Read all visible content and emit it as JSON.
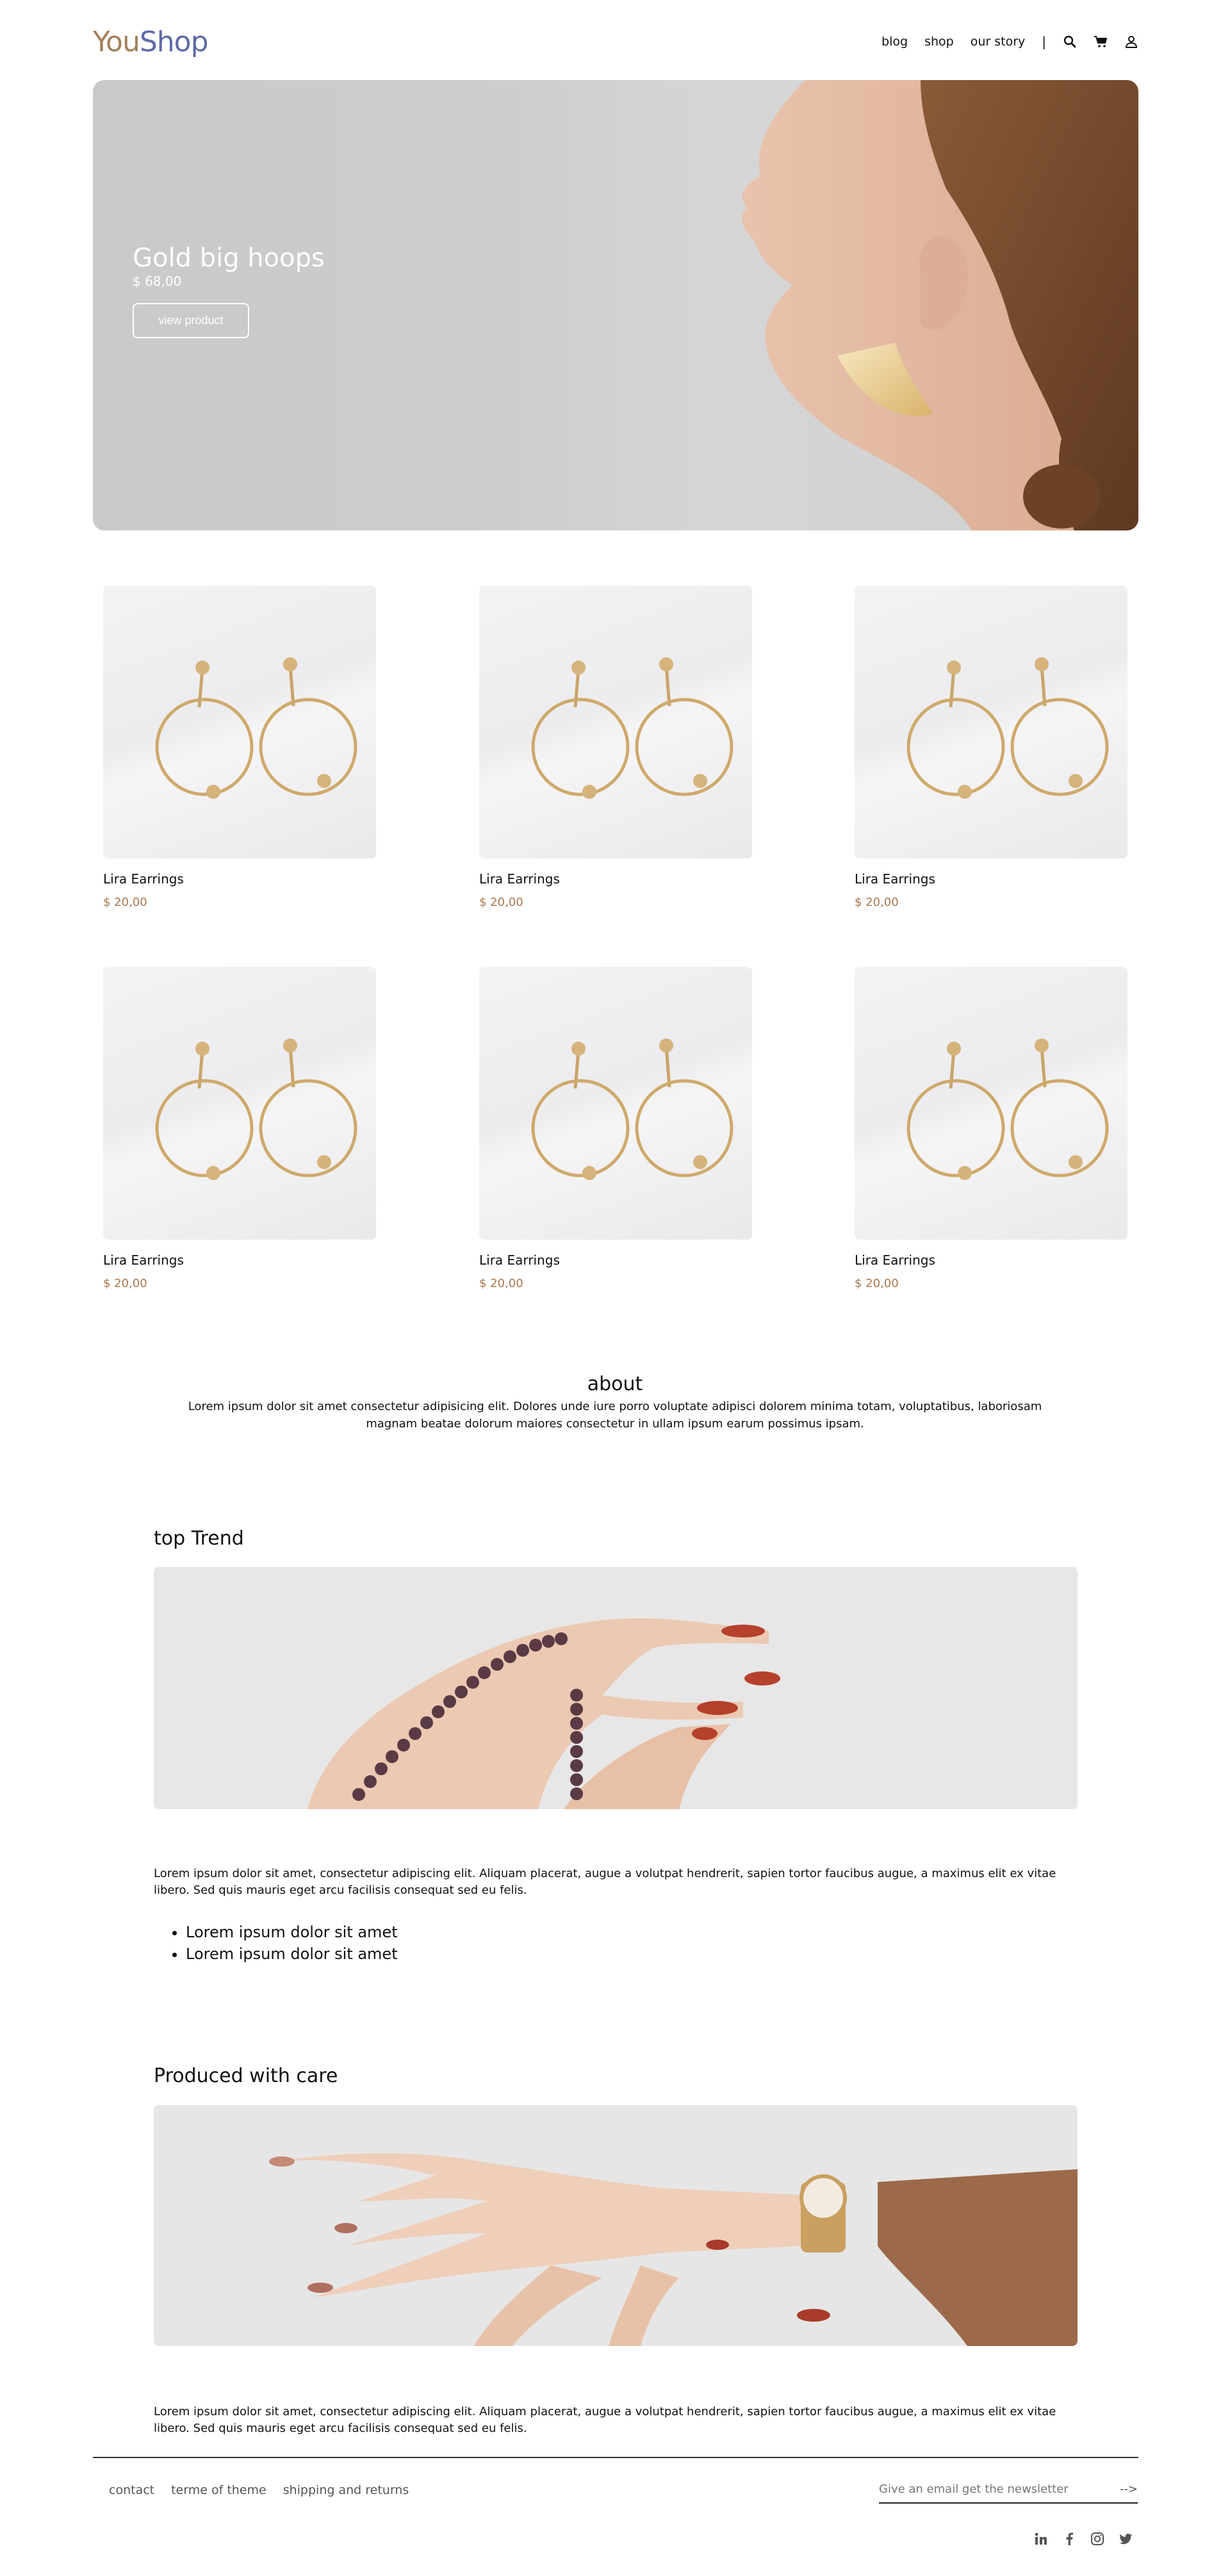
{
  "brand": {
    "logo_part1": "You",
    "logo_part2": "Shop"
  },
  "nav": {
    "blog": "blog",
    "shop": "shop",
    "our_story": "our story",
    "separator": "|"
  },
  "hero": {
    "title": "Gold big hoops",
    "price": "$ 68,00",
    "button": "view product"
  },
  "products": [
    {
      "name": "Lira Earrings",
      "price": "$ 20,00"
    },
    {
      "name": "Lira Earrings",
      "price": "$ 20,00"
    },
    {
      "name": "Lira Earrings",
      "price": "$ 20,00"
    },
    {
      "name": "Lira Earrings",
      "price": "$ 20,00"
    },
    {
      "name": "Lira Earrings",
      "price": "$ 20,00"
    },
    {
      "name": "Lira Earrings",
      "price": "$ 20,00"
    }
  ],
  "about": {
    "title": "about",
    "text": "Lorem ipsum dolor sit amet consectetur adipisicing elit. Dolores unde iure porro voluptate adipisci dolorem minima totam, voluptatibus, laboriosam magnam beatae dolorum maiores consectetur in ullam ipsum earum possimus ipsam."
  },
  "top_trend": {
    "title": "top Trend",
    "text": "Lorem ipsum dolor sit amet, consectetur adipiscing elit. Aliquam placerat, augue a volutpat hendrerit, sapien tortor faucibus augue, a maximus elit ex vitae libero. Sed quis mauris eget arcu facilisis consequat sed eu felis.",
    "bullets": [
      "Lorem ipsum dolor sit amet",
      "Lorem ipsum dolor sit amet"
    ]
  },
  "produced": {
    "title": "Produced with care",
    "text": "Lorem ipsum dolor sit amet, consectetur adipiscing elit. Aliquam placerat, augue a volutpat hendrerit, sapien tortor faucibus augue, a maximus elit ex vitae libero. Sed quis mauris eget arcu facilisis consequat sed eu felis."
  },
  "footer": {
    "links": [
      "contact",
      "terme of theme",
      "shipping and returns"
    ],
    "newsletter_placeholder": "Give an email get the newsletter",
    "newsletter_arrow": "-->",
    "socials": [
      "linkedin-icon",
      "facebook-icon",
      "instagram-icon",
      "twitter-icon"
    ]
  },
  "colors": {
    "logo_you": "#a4805c",
    "logo_shop": "#5f6aa8",
    "price": "#a9774e"
  }
}
